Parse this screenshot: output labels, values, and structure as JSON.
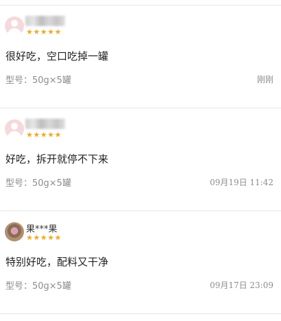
{
  "reviews": [
    {
      "name": "",
      "stars": "★★★★★",
      "content": "很好吃，空口吃掉一罐",
      "spec": "型号：50g×5罐",
      "time": "刚刚"
    },
    {
      "name": "",
      "stars": "★★★★★",
      "content": "好吃，拆开就停不下来",
      "spec": "型号：50g×5罐",
      "time": "09月19日 11:42"
    },
    {
      "name": "果***果",
      "stars": "★★★★★",
      "content": "特别好吃，配料又干净",
      "spec": "型号：50g×5罐",
      "time": "09月17日 23:09"
    }
  ],
  "colors": {
    "star": "#f5a623",
    "divider": "#e6e6e6",
    "meta_text": "#8c8c8c"
  }
}
